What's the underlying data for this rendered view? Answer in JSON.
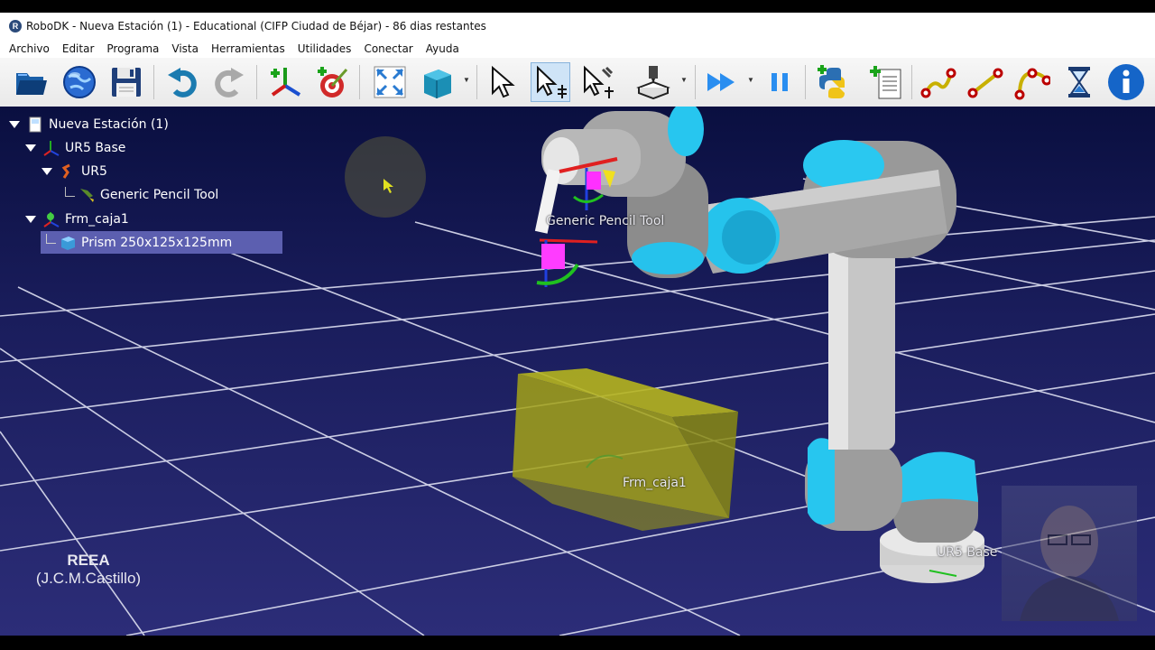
{
  "window": {
    "title": "RoboDK - Nueva Estación (1) - Educational (CIFP Ciudad de Béjar) - 86 dias restantes"
  },
  "menu": [
    "Archivo",
    "Editar",
    "Programa",
    "Vista",
    "Herramientas",
    "Utilidades",
    "Conectar",
    "Ayuda"
  ],
  "toolbar": {
    "buttons": [
      "open-folder-icon",
      "open-library-globe-icon",
      "save-icon",
      "undo-icon",
      "redo-icon",
      "add-reference-frame-icon",
      "add-target-icon",
      "fit-all-icon",
      "view-iso-cube-icon",
      "select-icon",
      "move-reference-icon",
      "move-tool-icon",
      "teach-target-icon",
      "fast-simulation-icon",
      "pause-simulation-icon",
      "add-python-program-icon",
      "add-program-icon",
      "move-joint-instruction-icon",
      "move-linear-instruction-icon",
      "move-circular-instruction-icon",
      "pause-instruction-icon",
      "info-icon"
    ]
  },
  "tree": {
    "station": "Nueva Estación (1)",
    "base": "UR5 Base",
    "robot": "UR5",
    "tool": "Generic Pencil Tool",
    "frame": "Frm_caja1",
    "object": "Prism 250x125x125mm"
  },
  "viewport_labels": {
    "tool": "Generic Pencil Tool",
    "frame": "Frm_caja1",
    "base": "UR5 Base"
  },
  "watermark": {
    "line1": "REEA",
    "line2": "(J.C.M.Castillo)"
  },
  "colors": {
    "background_top": "#0a0f40",
    "background_bottom": "#2c2d78",
    "grid": "#d8d8e8",
    "robot_cap": "#2ec9f0",
    "robot_link": "#9a9a9a",
    "prism": "#b8b820",
    "selection": "#5c5fb0"
  }
}
